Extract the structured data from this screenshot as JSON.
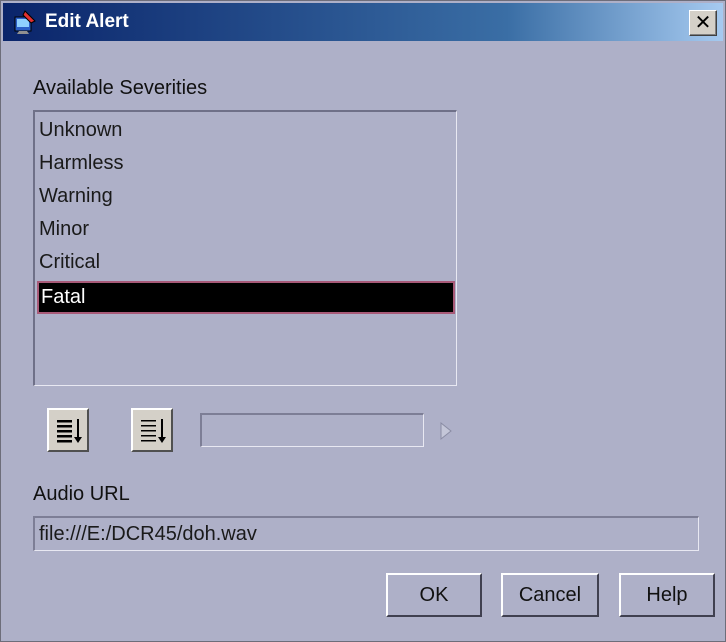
{
  "window": {
    "title": "Edit Alert",
    "close_label": "✕"
  },
  "severities": {
    "label": "Available Severities",
    "items": [
      "Unknown",
      "Harmless",
      "Warning",
      "Minor",
      "Critical",
      "Fatal"
    ],
    "selected": "Fatal"
  },
  "toolbar": {
    "left_icon": "list-sort-icon",
    "right_icon": "list-sort-alt-icon",
    "arrow_icon": "triangle-right-icon"
  },
  "audio": {
    "label": "Audio URL",
    "value": "file:///E:/DCR45/doh.wav"
  },
  "buttons": {
    "ok": "OK",
    "cancel": "Cancel",
    "help": "Help"
  }
}
